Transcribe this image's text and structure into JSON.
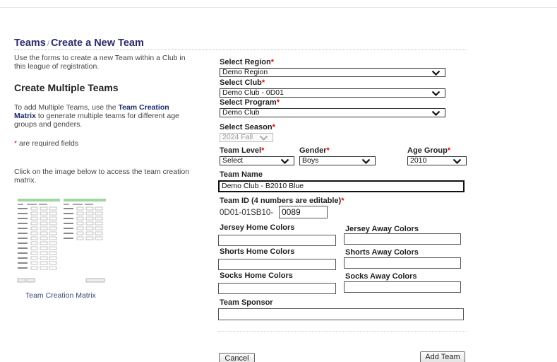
{
  "header": {
    "section": "Teams",
    "separator": "/",
    "page_title": "Create a New Team"
  },
  "left": {
    "intro": "Use the forms to create a new Team within a Club in this league of registration.",
    "multi_heading": "Create Multiple Teams",
    "multi_text_before": "To add Multiple Teams, use the",
    "multi_link": "Team Creation Matrix",
    "multi_text_after": "to generate multiple teams for different age groups and genders.",
    "required_star": "*",
    "required_text": "are required fields",
    "click_text": "Click on the image below to access the team creation matrix.",
    "matrix_caption": "Team Creation Matrix"
  },
  "form": {
    "required_star": "*",
    "region": {
      "label": "Select Region",
      "value": "Demo Region"
    },
    "club": {
      "label": "Select Club",
      "value": "Demo Club - 0D01"
    },
    "program": {
      "label": "Select Program",
      "value": "Demo Club"
    },
    "season": {
      "label": "Select Season",
      "value": "2024 Fall"
    },
    "team_level": {
      "label": "Team Level",
      "value": "Select"
    },
    "gender": {
      "label": "Gender",
      "value": "Boys"
    },
    "age_group": {
      "label": "Age Group",
      "value": "2010"
    },
    "team_name": {
      "label": "Team Name",
      "value": "Demo Club - B2010 Blue"
    },
    "team_id": {
      "label": "Team ID (4 numbers are editable)",
      "prefix": "0D01-01SB10-",
      "value": "0089"
    },
    "jersey_home": {
      "label": "Jersey Home Colors",
      "value": ""
    },
    "jersey_away": {
      "label": "Jersey Away Colors",
      "value": ""
    },
    "shorts_home": {
      "label": "Shorts Home Colors",
      "value": ""
    },
    "shorts_away": {
      "label": "Shorts Away Colors",
      "value": ""
    },
    "socks_home": {
      "label": "Socks Home Colors",
      "value": ""
    },
    "socks_away": {
      "label": "Socks Away Colors",
      "value": ""
    },
    "sponsor": {
      "label": "Team Sponsor",
      "value": ""
    },
    "cancel_label": "Cancel",
    "add_label": "Add Team"
  }
}
